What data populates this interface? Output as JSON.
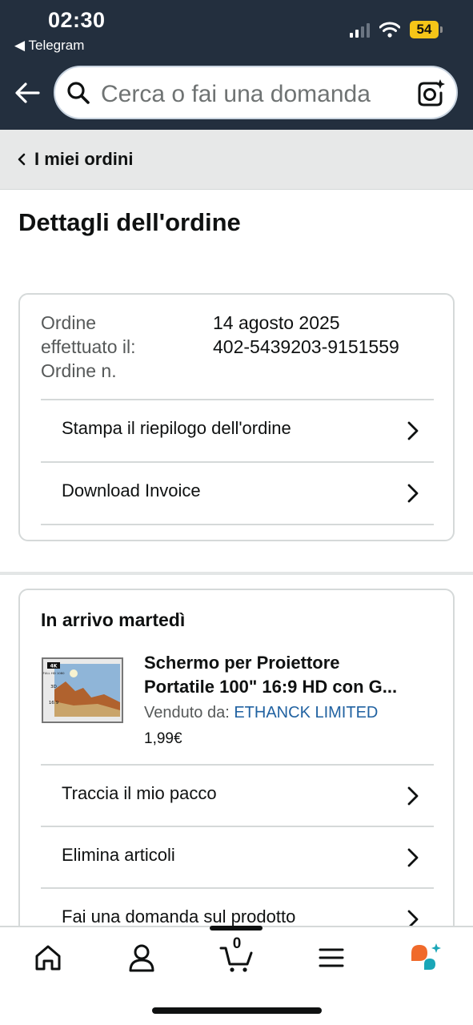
{
  "status_bar": {
    "time": "02:30",
    "back_app": "◀ Telegram",
    "battery": "54"
  },
  "search": {
    "placeholder": "Cerca o fai una domanda"
  },
  "breadcrumb": {
    "label": "I miei ordini"
  },
  "page_title": "Dettagli dell'ordine",
  "order_info": {
    "labels": [
      "Ordine",
      "effettuato il:",
      "Ordine n."
    ],
    "date": "14 agosto 2025",
    "number": "402-5439203-9151559"
  },
  "order_actions": [
    {
      "label": "Stampa il riepilogo dell'ordine"
    },
    {
      "label": "Download Invoice"
    }
  ],
  "shipment": {
    "status": "In arrivo martedì",
    "product": {
      "title_line1": "Schermo per Proiettore",
      "title_line2": "Portatile 100\" 16:9 HD con G...",
      "seller_label": "Venduto da:",
      "seller_name": "ETHANCK LIMITED",
      "price": "1,99€",
      "thumb_badges": [
        "4K",
        "FULL HD 1080",
        "3D",
        "16:9"
      ]
    },
    "actions": [
      {
        "label": "Traccia il mio pacco"
      },
      {
        "label": "Elimina articoli"
      },
      {
        "label": "Fai una domanda sul prodotto"
      }
    ]
  },
  "bottom_nav": {
    "cart_count": "0"
  },
  "colors": {
    "header_bg": "#232f3e",
    "link": "#2162a1",
    "battery": "#f5c518",
    "rufus_orange": "#f06a2b",
    "rufus_teal": "#1aa6b7"
  }
}
